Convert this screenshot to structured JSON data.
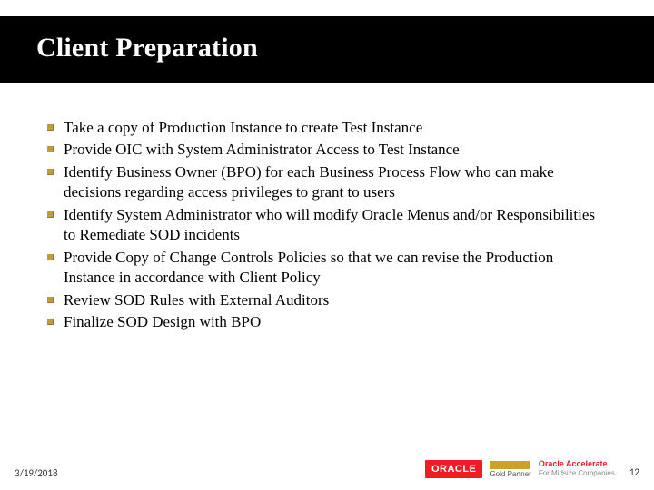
{
  "title": "Client Preparation",
  "bullets": [
    "Take a copy of Production Instance to create Test Instance",
    "Provide OIC with System Administrator Access to Test Instance",
    "Identify Business Owner (BPO) for each Business Process Flow who can make decisions regarding access privileges to grant to users",
    "Identify System Administrator who will modify Oracle Menus and/or Responsibilities to Remediate SOD incidents",
    "Provide Copy of Change Controls Policies so that we can revise the Production Instance in accordance with Client Policy",
    "Review SOD Rules with External Auditors",
    "Finalize SOD Design with BPO"
  ],
  "footer": {
    "date": "3/19/2018",
    "oracle": "ORACLE",
    "gold_label": "Gold",
    "partner_label": "Partner",
    "accelerate_line1": "Oracle Accelerate",
    "accelerate_line2": "For Midsize Companies",
    "page": "12"
  }
}
